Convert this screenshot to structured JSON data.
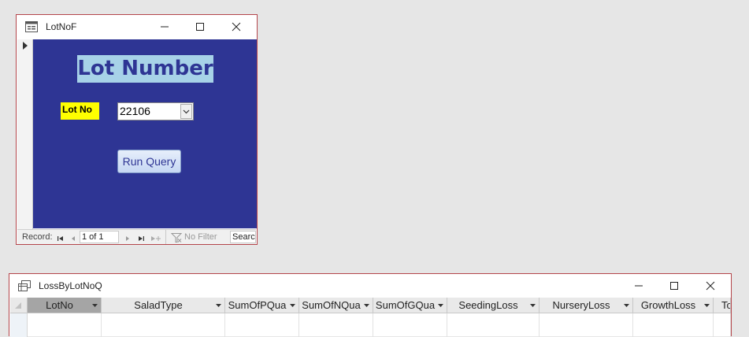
{
  "form_window": {
    "title": "LotNoF",
    "heading": "Lot Number",
    "lot_label": "Lot No",
    "lot_value": "22106",
    "run_button": "Run Query",
    "nav": {
      "record_label": "Record:",
      "position": "1 of 1",
      "filter": "No Filter",
      "search": "Search"
    }
  },
  "grid_window": {
    "title": "LossByLotNoQ",
    "columns": [
      "LotNo",
      "SaladType",
      "SumOfPQua",
      "SumOfNQua",
      "SumOfGQua",
      "SeedingLoss",
      "NurseryLoss",
      "GrowthLoss",
      "To"
    ]
  },
  "colors": {
    "form_background": "#2e3594",
    "heading_background": "#a7d2e8",
    "label_background": "#ffff00",
    "window_border": "#b4454b"
  },
  "icons": {
    "form": "form-window-icon",
    "query": "query-window-icon",
    "minimize": "minimize-icon",
    "maximize": "maximize-icon",
    "close": "close-icon"
  }
}
